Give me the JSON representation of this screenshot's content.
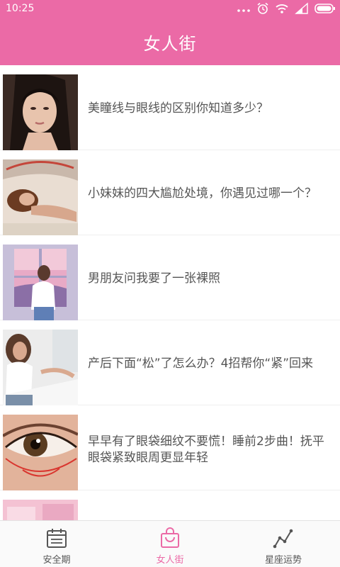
{
  "status_bar": {
    "time": "10:25",
    "icons": [
      "more-dots-icon",
      "alarm-icon",
      "wifi-icon",
      "signal-icon",
      "battery-icon"
    ]
  },
  "app_bar": {
    "title": "女人街"
  },
  "articles": [
    {
      "title": "美瞳线与眼线的区别你知道多少？",
      "thumb_icon": "woman-portrait-photo"
    },
    {
      "title": "小妹妹的四大尴尬处境，你遇见过哪一个？",
      "thumb_icon": "woman-lying-sand-photo"
    },
    {
      "title": "男朋友问我要了一张裸照",
      "thumb_icon": "girl-at-window-illustration"
    },
    {
      "title": "产后下面“松”了怎么办？4招帮你“紧”回来",
      "thumb_icon": "woman-on-bed-photo"
    },
    {
      "title": "早早有了眼袋细纹不要慌！睡前2步曲！抚平眼袋紧致眼周更显年轻",
      "thumb_icon": "eye-closeup-photo"
    },
    {
      "title": "",
      "thumb_icon": "pink-pattern-photo"
    }
  ],
  "tabs": [
    {
      "label": "安全期",
      "icon": "calendar-icon",
      "active": false
    },
    {
      "label": "女人街",
      "icon": "shopping-bag-icon",
      "active": true
    },
    {
      "label": "星座运势",
      "icon": "trend-line-icon",
      "active": false
    }
  ],
  "colors": {
    "accent": "#eb6aa6",
    "text": "#555555",
    "inactive_icon": "#555555"
  }
}
